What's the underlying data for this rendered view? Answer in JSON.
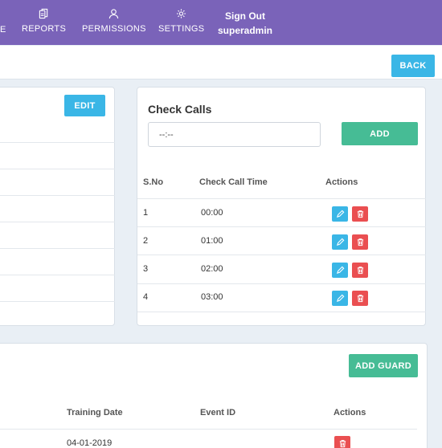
{
  "nav": {
    "partial_left": "E",
    "items": [
      {
        "label": "REPORTS",
        "icon": "reports-icon"
      },
      {
        "label": "PERMISSIONS",
        "icon": "user-icon"
      },
      {
        "label": "SETTINGS",
        "icon": "gear-icon"
      }
    ],
    "signout_label": "Sign Out",
    "username": "superadmin"
  },
  "subheader": {
    "back_label": "BACK"
  },
  "left_card": {
    "edit_label": "EDIT"
  },
  "check_calls": {
    "title": "Check Calls",
    "time_input_value": "--:--",
    "add_label": "ADD",
    "columns": [
      "S.No",
      "Check Call Time",
      "Actions"
    ],
    "rows": [
      {
        "sno": "1",
        "time": "00:00"
      },
      {
        "sno": "2",
        "time": "01:00"
      },
      {
        "sno": "3",
        "time": "02:00"
      },
      {
        "sno": "4",
        "time": "03:00"
      }
    ]
  },
  "guards": {
    "add_label": "ADD GUARD",
    "columns": [
      "Training Date",
      "Event ID",
      "Actions"
    ],
    "rows": [
      {
        "training_date": "04-01-2019",
        "event_id": ""
      }
    ]
  },
  "colors": {
    "nav_bg": "#7a63b9",
    "accent_blue": "#3ab6e6",
    "accent_green": "#46bc95",
    "danger_red": "#ea4f51",
    "page_bg": "#e9eff5"
  }
}
